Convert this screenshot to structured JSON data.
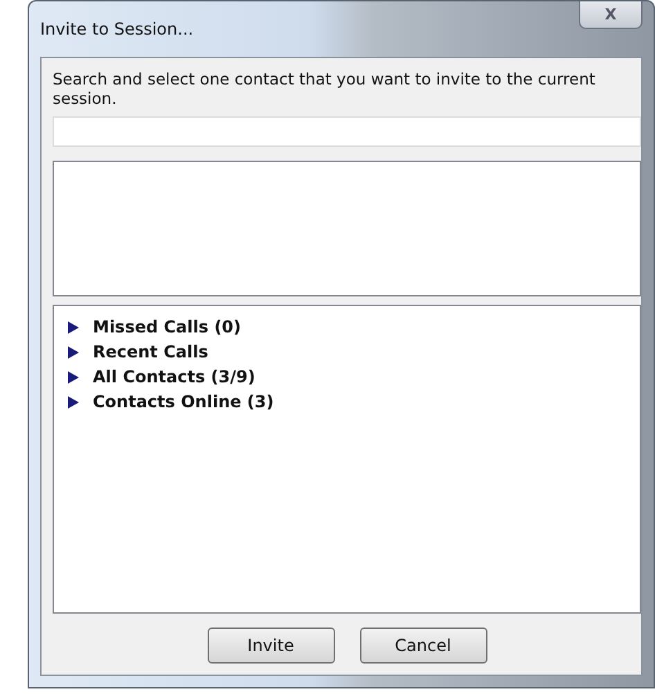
{
  "window": {
    "title": "Invite to Session...",
    "close_glyph": "X"
  },
  "instructions": "Search and select one contact that you want to invite to the current session.",
  "tree": [
    {
      "label": "Missed Calls (0)",
      "expanded": false
    },
    {
      "label": "Recent Calls",
      "expanded": false
    },
    {
      "label": "All Contacts (3/9)",
      "expanded": false
    },
    {
      "label": "Contacts Online (3)",
      "expanded": false
    }
  ],
  "buttons": [
    "Invite",
    "Cancel"
  ]
}
